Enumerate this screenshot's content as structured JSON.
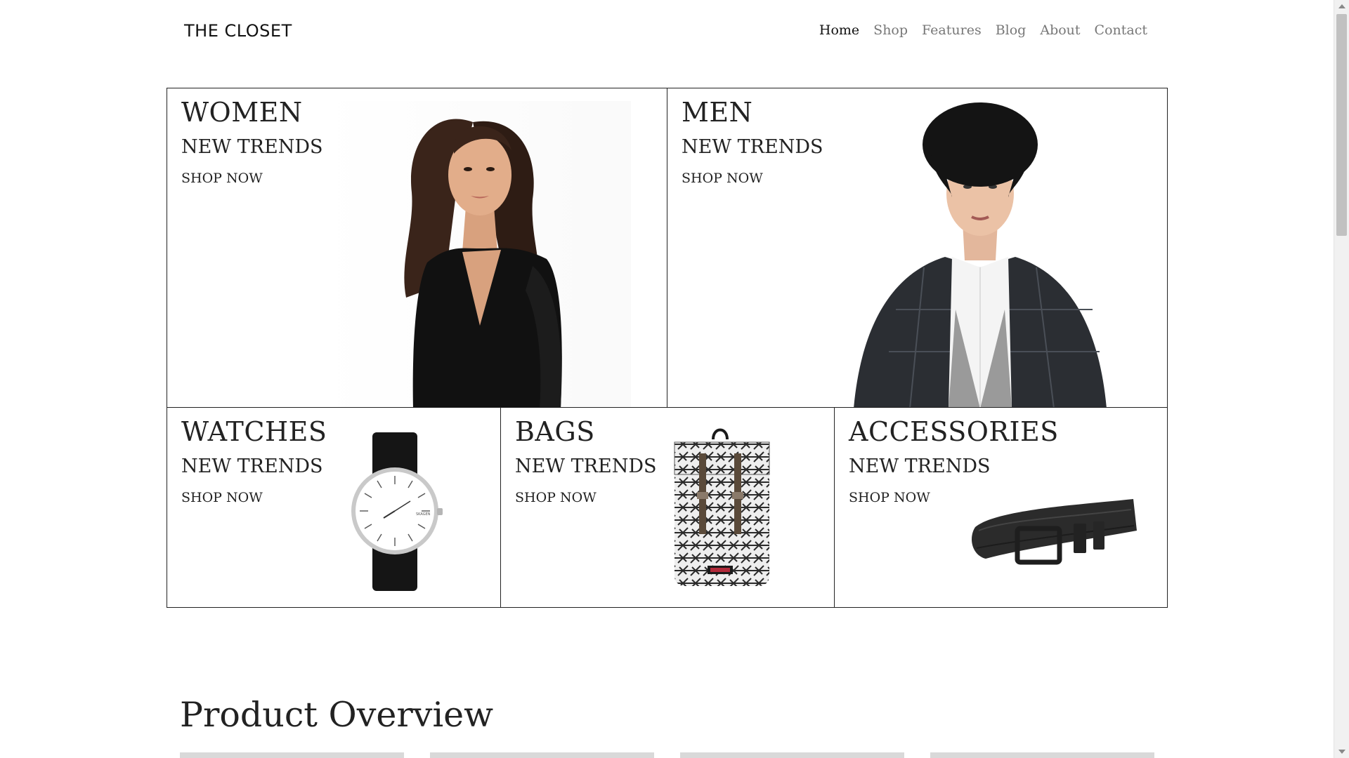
{
  "header": {
    "logo": "THE CLOSET",
    "nav": [
      "Home",
      "Shop",
      "Features",
      "Blog",
      "About",
      "Contact"
    ],
    "active_nav": "Home"
  },
  "categories": [
    {
      "title": "WOMEN",
      "subtitle": "NEW TRENDS",
      "cta": "SHOP NOW",
      "image": "woman-model-photo"
    },
    {
      "title": "MEN",
      "subtitle": "NEW TRENDS",
      "cta": "SHOP NOW",
      "image": "man-model-photo"
    },
    {
      "title": "WATCHES",
      "subtitle": "NEW TRENDS",
      "cta": "SHOP NOW",
      "image": "watch-photo"
    },
    {
      "title": "BAGS",
      "subtitle": "NEW TRENDS",
      "cta": "SHOP NOW",
      "image": "backpack-photo"
    },
    {
      "title": "ACCESSORIES",
      "subtitle": "NEW TRENDS",
      "cta": "SHOP NOW",
      "image": "belt-photo"
    }
  ],
  "watch_brand": "SKAGEN",
  "overview": {
    "title": "Product Overview"
  },
  "colors": {
    "text": "#222222",
    "nav_inactive": "#777777",
    "border": "#222222"
  }
}
